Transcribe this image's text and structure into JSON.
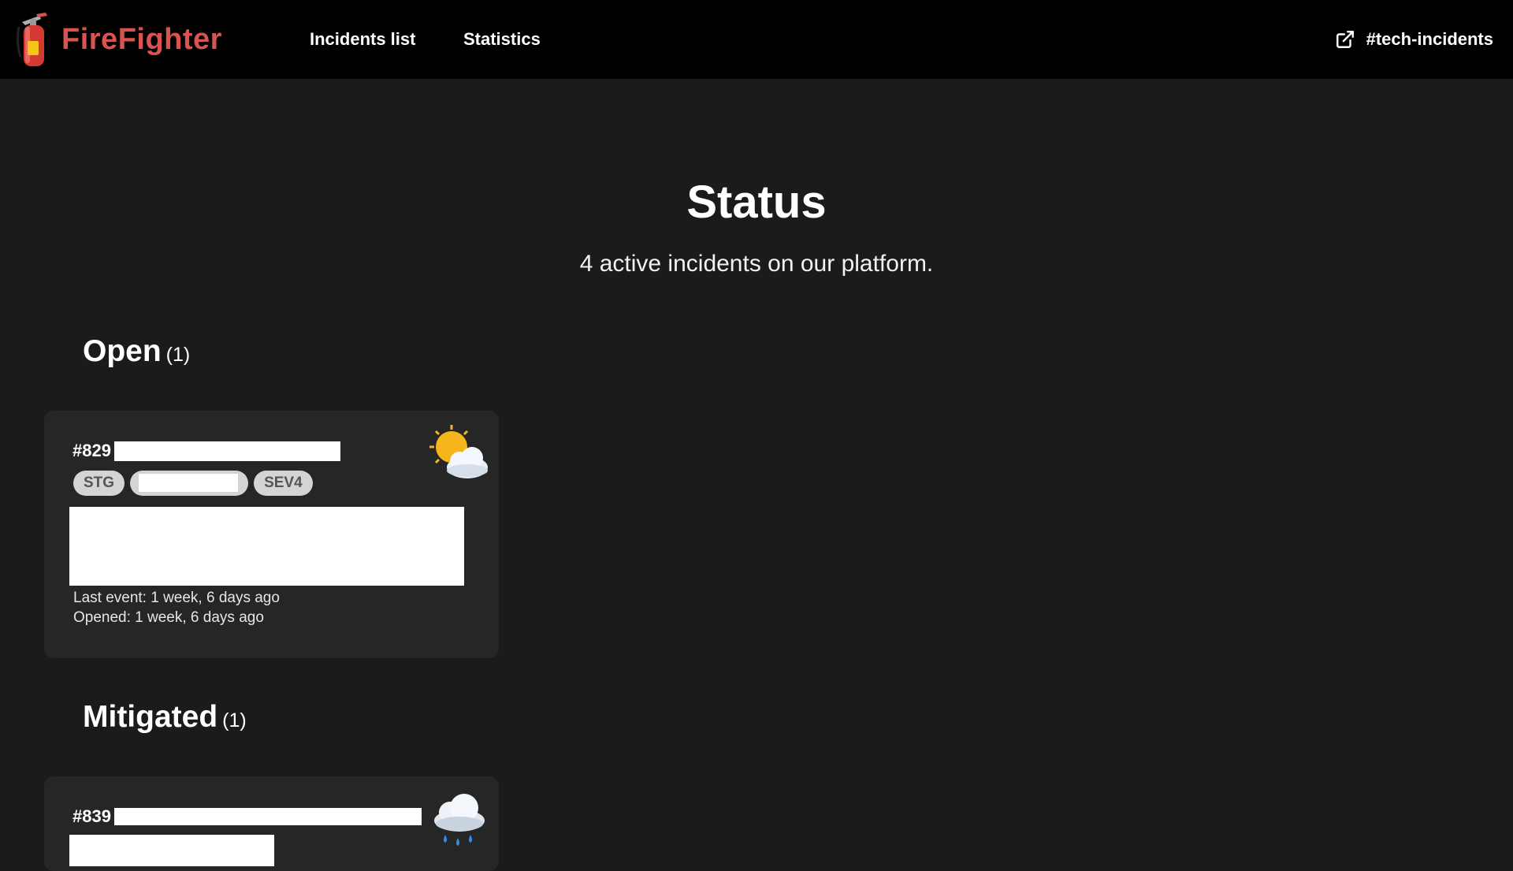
{
  "navbar": {
    "brand": "FireFighter",
    "links": {
      "incidents": "Incidents list",
      "statistics": "Statistics"
    },
    "slack_channel": "#tech-incidents"
  },
  "hero": {
    "title": "Status",
    "subtitle": "4 active incidents on our platform."
  },
  "sections": {
    "open": {
      "title": "Open",
      "count": "(1)",
      "incidents": [
        {
          "id": "#829",
          "weather_icon": "sun-behind-cloud-icon",
          "tags": [
            "STG",
            "SEV4"
          ],
          "last_event": "Last event: 1 week, 6 days ago",
          "opened": "Opened: 1 week, 6 days ago"
        }
      ]
    },
    "mitigated": {
      "title": "Mitigated",
      "count": "(1)",
      "incidents": [
        {
          "id": "#839",
          "weather_icon": "cloud-with-rain-icon"
        }
      ]
    }
  },
  "colors": {
    "brand": "#d9534f",
    "background": "#1b1b1b",
    "navbar": "#000000",
    "card": "#262626",
    "tag_bg": "#d4d4d4",
    "tag_text": "#555555"
  }
}
